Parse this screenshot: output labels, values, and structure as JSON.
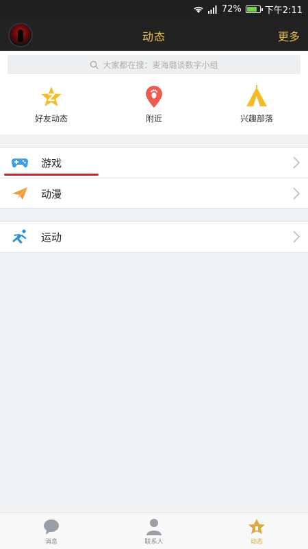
{
  "status_bar": {
    "battery_text": "72%",
    "time": "下午2:11",
    "battery_level": 0.72
  },
  "header": {
    "title": "动态",
    "more": "更多"
  },
  "search": {
    "placeholder": "大家都在搜：麦海璐谈数字小组"
  },
  "quick": [
    {
      "label": "好友动态",
      "icon": "star-icon"
    },
    {
      "label": "附近",
      "icon": "location-pin-icon"
    },
    {
      "label": "兴趣部落",
      "icon": "tent-icon"
    }
  ],
  "list_groups": [
    [
      {
        "label": "游戏",
        "icon": "gamepad-icon"
      },
      {
        "label": "动漫",
        "icon": "paper-plane-icon"
      }
    ],
    [
      {
        "label": "运动",
        "icon": "runner-icon"
      }
    ]
  ],
  "tabs": [
    {
      "label": "消息",
      "icon": "chat-bubble-icon"
    },
    {
      "label": "联系人",
      "icon": "person-icon"
    },
    {
      "label": "动态",
      "icon": "star-house-icon"
    }
  ],
  "colors": {
    "accent": "#e8c04f",
    "annotation_red": "#c0242c"
  }
}
